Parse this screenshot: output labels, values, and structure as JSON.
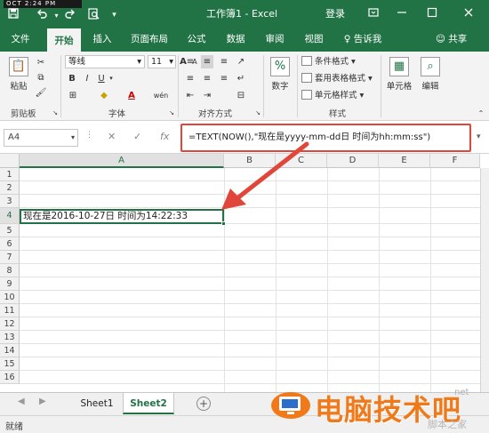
{
  "titlebar": {
    "clock": "OCT  2:24 PM",
    "title": "工作簿1 - Excel",
    "login": "登录",
    "save_icon": "save-icon",
    "undo_icon": "undo-icon",
    "redo_icon": "redo-icon",
    "preview_icon": "print-preview-icon"
  },
  "tabs": [
    {
      "label": "文件"
    },
    {
      "label": "开始"
    },
    {
      "label": "插入"
    },
    {
      "label": "页面布局"
    },
    {
      "label": "公式"
    },
    {
      "label": "数据"
    },
    {
      "label": "审阅"
    },
    {
      "label": "视图"
    },
    {
      "label": "告诉我"
    }
  ],
  "share_label": "共享",
  "ribbon": {
    "clipboard": {
      "paste": "粘贴",
      "label": "剪贴板"
    },
    "font": {
      "name": "等线",
      "size": "11",
      "label": "字体",
      "bold": "B",
      "italic": "I",
      "underline": "U",
      "grow": "A",
      "shrink": "A",
      "color_a": "A",
      "wen": "wén"
    },
    "alignment": {
      "label": "对齐方式"
    },
    "number": {
      "big": "数字",
      "pct": "%"
    },
    "styles": {
      "cond": "条件格式",
      "table": "套用表格格式",
      "cell": "单元格样式",
      "label": "样式"
    },
    "cells": {
      "big": "单元格"
    },
    "editing": {
      "big": "编辑"
    }
  },
  "formula_bar": {
    "name_box": "A4",
    "formula": "=TEXT(NOW(),\"现在是yyyy-mm-dd日 时间为hh:mm:ss\")"
  },
  "grid": {
    "columns": [
      "A",
      "B",
      "C",
      "D",
      "E",
      "F"
    ],
    "rows": [
      "1",
      "2",
      "3",
      "4",
      "5",
      "6",
      "7",
      "8",
      "9",
      "10",
      "11",
      "12",
      "13",
      "14",
      "15",
      "16"
    ],
    "cell_A4": "现在是2016-10-27日 时间为14:22:33"
  },
  "sheets": [
    {
      "label": "Sheet1",
      "active": false
    },
    {
      "label": "Sheet2",
      "active": true
    }
  ],
  "status": "就绪",
  "watermark": {
    "brand": "电脑技术吧",
    "net": "net",
    "sub": "脚本之家"
  },
  "colors": {
    "excel_green": "#217346",
    "highlight_red": "#e0473a",
    "watermark_orange": "#f07a1a"
  }
}
